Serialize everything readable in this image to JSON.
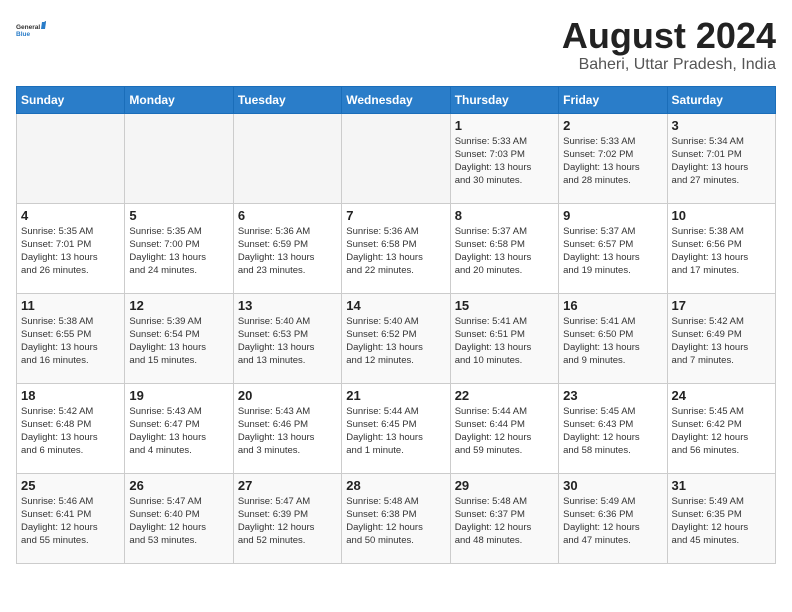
{
  "header": {
    "logo_general": "General",
    "logo_blue": "Blue",
    "title": "August 2024",
    "subtitle": "Baheri, Uttar Pradesh, India"
  },
  "calendar": {
    "days_of_week": [
      "Sunday",
      "Monday",
      "Tuesday",
      "Wednesday",
      "Thursday",
      "Friday",
      "Saturday"
    ],
    "weeks": [
      [
        {
          "day": "",
          "info": ""
        },
        {
          "day": "",
          "info": ""
        },
        {
          "day": "",
          "info": ""
        },
        {
          "day": "",
          "info": ""
        },
        {
          "day": "1",
          "info": "Sunrise: 5:33 AM\nSunset: 7:03 PM\nDaylight: 13 hours\nand 30 minutes."
        },
        {
          "day": "2",
          "info": "Sunrise: 5:33 AM\nSunset: 7:02 PM\nDaylight: 13 hours\nand 28 minutes."
        },
        {
          "day": "3",
          "info": "Sunrise: 5:34 AM\nSunset: 7:01 PM\nDaylight: 13 hours\nand 27 minutes."
        }
      ],
      [
        {
          "day": "4",
          "info": "Sunrise: 5:35 AM\nSunset: 7:01 PM\nDaylight: 13 hours\nand 26 minutes."
        },
        {
          "day": "5",
          "info": "Sunrise: 5:35 AM\nSunset: 7:00 PM\nDaylight: 13 hours\nand 24 minutes."
        },
        {
          "day": "6",
          "info": "Sunrise: 5:36 AM\nSunset: 6:59 PM\nDaylight: 13 hours\nand 23 minutes."
        },
        {
          "day": "7",
          "info": "Sunrise: 5:36 AM\nSunset: 6:58 PM\nDaylight: 13 hours\nand 22 minutes."
        },
        {
          "day": "8",
          "info": "Sunrise: 5:37 AM\nSunset: 6:58 PM\nDaylight: 13 hours\nand 20 minutes."
        },
        {
          "day": "9",
          "info": "Sunrise: 5:37 AM\nSunset: 6:57 PM\nDaylight: 13 hours\nand 19 minutes."
        },
        {
          "day": "10",
          "info": "Sunrise: 5:38 AM\nSunset: 6:56 PM\nDaylight: 13 hours\nand 17 minutes."
        }
      ],
      [
        {
          "day": "11",
          "info": "Sunrise: 5:38 AM\nSunset: 6:55 PM\nDaylight: 13 hours\nand 16 minutes."
        },
        {
          "day": "12",
          "info": "Sunrise: 5:39 AM\nSunset: 6:54 PM\nDaylight: 13 hours\nand 15 minutes."
        },
        {
          "day": "13",
          "info": "Sunrise: 5:40 AM\nSunset: 6:53 PM\nDaylight: 13 hours\nand 13 minutes."
        },
        {
          "day": "14",
          "info": "Sunrise: 5:40 AM\nSunset: 6:52 PM\nDaylight: 13 hours\nand 12 minutes."
        },
        {
          "day": "15",
          "info": "Sunrise: 5:41 AM\nSunset: 6:51 PM\nDaylight: 13 hours\nand 10 minutes."
        },
        {
          "day": "16",
          "info": "Sunrise: 5:41 AM\nSunset: 6:50 PM\nDaylight: 13 hours\nand 9 minutes."
        },
        {
          "day": "17",
          "info": "Sunrise: 5:42 AM\nSunset: 6:49 PM\nDaylight: 13 hours\nand 7 minutes."
        }
      ],
      [
        {
          "day": "18",
          "info": "Sunrise: 5:42 AM\nSunset: 6:48 PM\nDaylight: 13 hours\nand 6 minutes."
        },
        {
          "day": "19",
          "info": "Sunrise: 5:43 AM\nSunset: 6:47 PM\nDaylight: 13 hours\nand 4 minutes."
        },
        {
          "day": "20",
          "info": "Sunrise: 5:43 AM\nSunset: 6:46 PM\nDaylight: 13 hours\nand 3 minutes."
        },
        {
          "day": "21",
          "info": "Sunrise: 5:44 AM\nSunset: 6:45 PM\nDaylight: 13 hours\nand 1 minute."
        },
        {
          "day": "22",
          "info": "Sunrise: 5:44 AM\nSunset: 6:44 PM\nDaylight: 12 hours\nand 59 minutes."
        },
        {
          "day": "23",
          "info": "Sunrise: 5:45 AM\nSunset: 6:43 PM\nDaylight: 12 hours\nand 58 minutes."
        },
        {
          "day": "24",
          "info": "Sunrise: 5:45 AM\nSunset: 6:42 PM\nDaylight: 12 hours\nand 56 minutes."
        }
      ],
      [
        {
          "day": "25",
          "info": "Sunrise: 5:46 AM\nSunset: 6:41 PM\nDaylight: 12 hours\nand 55 minutes."
        },
        {
          "day": "26",
          "info": "Sunrise: 5:47 AM\nSunset: 6:40 PM\nDaylight: 12 hours\nand 53 minutes."
        },
        {
          "day": "27",
          "info": "Sunrise: 5:47 AM\nSunset: 6:39 PM\nDaylight: 12 hours\nand 52 minutes."
        },
        {
          "day": "28",
          "info": "Sunrise: 5:48 AM\nSunset: 6:38 PM\nDaylight: 12 hours\nand 50 minutes."
        },
        {
          "day": "29",
          "info": "Sunrise: 5:48 AM\nSunset: 6:37 PM\nDaylight: 12 hours\nand 48 minutes."
        },
        {
          "day": "30",
          "info": "Sunrise: 5:49 AM\nSunset: 6:36 PM\nDaylight: 12 hours\nand 47 minutes."
        },
        {
          "day": "31",
          "info": "Sunrise: 5:49 AM\nSunset: 6:35 PM\nDaylight: 12 hours\nand 45 minutes."
        }
      ]
    ]
  }
}
